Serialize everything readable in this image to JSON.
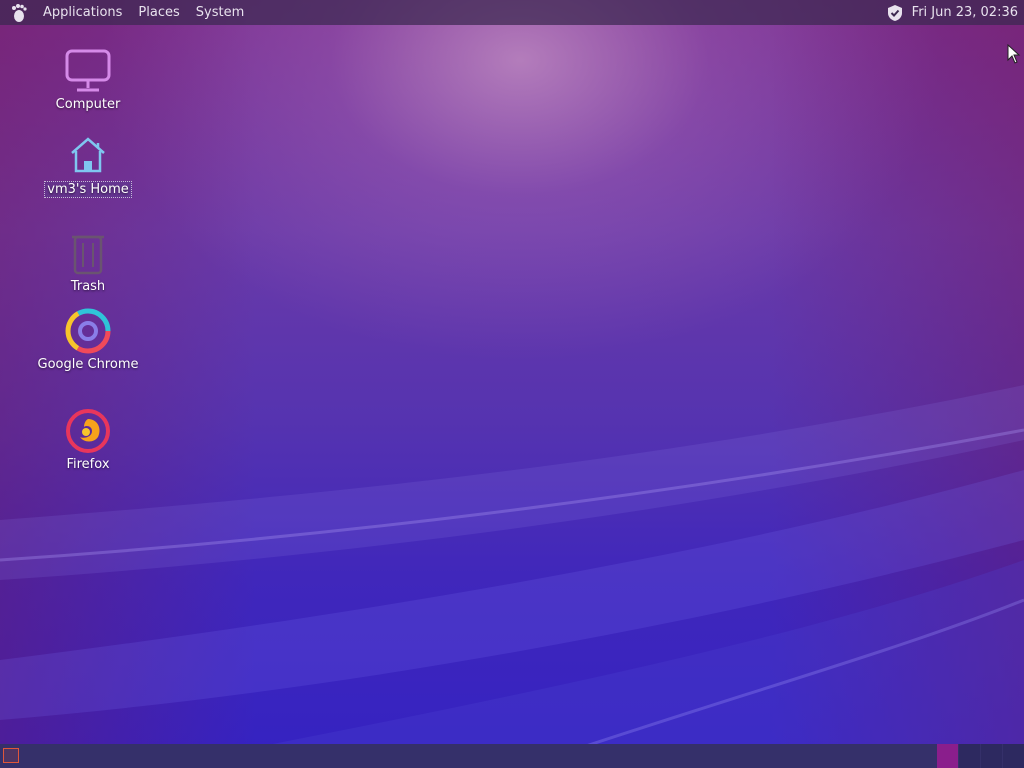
{
  "top_panel": {
    "menus": {
      "applications": "Applications",
      "places": "Places",
      "system": "System"
    },
    "clock": "Fri Jun 23, 02:36",
    "logo_icon": "gnome-foot-icon",
    "tray_icon": "shield-check-icon"
  },
  "desktop": {
    "icons": {
      "computer": {
        "label": "Computer",
        "icon": "monitor-icon"
      },
      "home": {
        "label": "vm3's Home",
        "icon": "home-folder-icon",
        "selected": true
      },
      "trash": {
        "label": "Trash",
        "icon": "trash-icon"
      },
      "chrome": {
        "label": "Google Chrome",
        "icon": "chrome-icon"
      },
      "firefox": {
        "label": "Firefox",
        "icon": "firefox-icon"
      }
    }
  },
  "bottom_panel": {
    "show_desktop_icon": "show-desktop-icon",
    "workspaces": {
      "count": 4,
      "active_index": 0
    }
  },
  "colors": {
    "panel_bg": "#3c2850",
    "wallpaper_top": "#7a2e8e",
    "wallpaper_bottom": "#3422c2",
    "active_workspace": "#8a1e8c",
    "show_desktop_accent": "#e0563a"
  }
}
